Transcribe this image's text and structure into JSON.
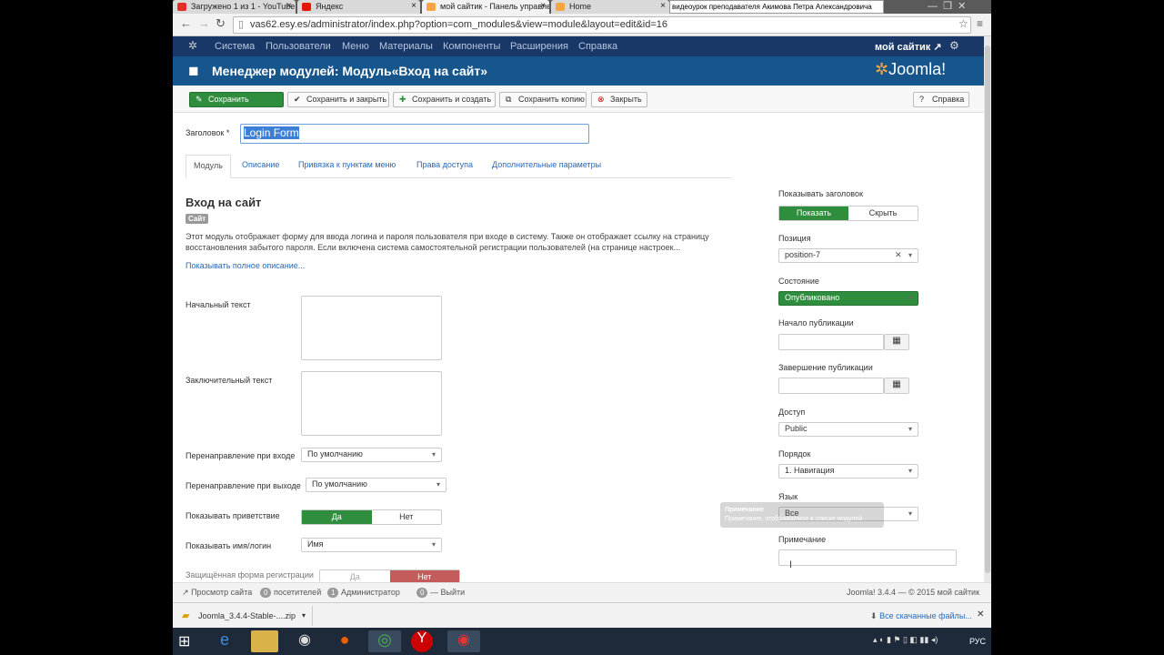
{
  "browser": {
    "tabs": [
      {
        "label": "Загружено 1 из 1 - YouTube"
      },
      {
        "label": "Яндекс"
      },
      {
        "label": "мой сайтик - Панель управления"
      },
      {
        "label": "Home"
      }
    ],
    "overlay_title": "видеоурок преподавателя Акимова Петра Александровича",
    "url": "vas62.esy.es/administrator/index.php?option=com_modules&view=module&layout=edit&id=16"
  },
  "jmenu": {
    "items": [
      "Система",
      "Пользователи",
      "Меню",
      "Материалы",
      "Компоненты",
      "Расширения",
      "Справка"
    ],
    "site_link": "мой сайтик",
    "gear": "gear-icon"
  },
  "header": {
    "title": "Менеджер модулей: Модуль«Вход на сайт»",
    "logo": "Joomla!"
  },
  "toolbar": {
    "save": "Сохранить",
    "save_close": "Сохранить и закрыть",
    "save_new": "Сохранить и создать",
    "save_copy": "Сохранить копию",
    "close": "Закрыть",
    "help": "Справка"
  },
  "form": {
    "title_label": "Заголовок *",
    "title_value": "Login Form",
    "tabs": [
      "Модуль",
      "Описание",
      "Привязка к пунктам меню",
      "Права доступа",
      "Дополнительные параметры"
    ],
    "module_name": "Вход на сайт",
    "badge": "Сайт",
    "description": "Этот модуль отображает форму для ввода логина и пароля пользователя при входе в систему. Также он отображает ссылку на страницу восстановления забытого пароля. Если включена система самостоятельной регистрации пользователей (на странице настроек...",
    "show_full": "Показывать полное описание...",
    "pretext_label": "Начальный текст",
    "posttext_label": "Заключительный текст",
    "login_redirect_label": "Перенаправление при входе",
    "login_redirect_value": "По умолчанию",
    "logout_redirect_label": "Перенаправление при выходе",
    "logout_redirect_value": "По умолчанию",
    "greeting_label": "Показывать приветствие",
    "yes": "Да",
    "no": "Нет",
    "name_label": "Показывать имя/логин",
    "name_value": "Имя",
    "secure_label": "Защищённая форма регистрации"
  },
  "side": {
    "show_title_label": "Показывать заголовок",
    "show": "Показать",
    "hide": "Скрыть",
    "position_label": "Позиция",
    "position_value": "position-7",
    "state_label": "Состояние",
    "state_value": "Опубликовано",
    "publish_up_label": "Начало публикации",
    "publish_down_label": "Завершение публикации",
    "access_label": "Доступ",
    "access_value": "Public",
    "ordering_label": "Порядок",
    "ordering_value": "1. Навигация",
    "language_label": "Язык",
    "language_value": "Все",
    "note_label": "Примечание",
    "tooltip_title": "Примечание",
    "tooltip_text": "Примечание, отображаемое в списке модулей"
  },
  "status": {
    "view_site": "Просмотр сайта",
    "visitors_count": "0",
    "visitors": "посетителей",
    "admins_count": "1",
    "admins": "Администратор",
    "logout_count": "0",
    "logout": "Выйти",
    "version": "Joomla! 3.4.4 — © 2015 мой сайтик"
  },
  "download": {
    "file": "Joomla_3.4.4-Stable-....zip",
    "all": "Все скачанные файлы..."
  },
  "taskbar": {
    "lang": "РУС"
  }
}
